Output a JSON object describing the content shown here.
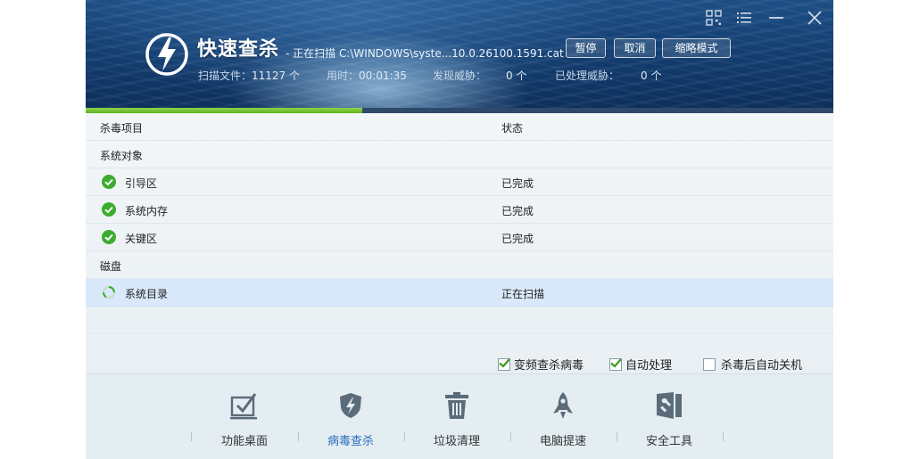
{
  "header": {
    "title": "快速查杀",
    "scan_status": " - 正在扫描 C:\\WINDOWS\\syste...10.0.26100.1591.cat",
    "buttons": {
      "pause": "暂停",
      "cancel": "取消",
      "mini": "缩略模式"
    },
    "stats": {
      "files_label": "扫描文件：",
      "files_value": "11127 个",
      "time_label": "用时：",
      "time_value": "00:01:35",
      "threats_label": "发现威胁：",
      "threats_value": "0 个",
      "handled_label": "已处理威胁：",
      "handled_value": "0 个"
    }
  },
  "progress": {
    "fraction": 0.37
  },
  "table": {
    "col_item": "杀毒项目",
    "col_status": "状态",
    "group_system": "系统对象",
    "rows": [
      {
        "name": "引导区",
        "status": "已完成"
      },
      {
        "name": "系统内存",
        "status": "已完成"
      },
      {
        "name": "关键区",
        "status": "已完成"
      }
    ],
    "group_disk": "磁盘",
    "scanning_row": {
      "name": "系统目录",
      "status": "正在扫描"
    }
  },
  "options": {
    "freq": "变频查杀病毒",
    "auto": "自动处理",
    "shutdown": "杀毒后自动关机"
  },
  "nav": {
    "desktop": "功能桌面",
    "virus": "病毒查杀",
    "trash": "垃圾清理",
    "speed": "电脑提速",
    "tools": "安全工具"
  },
  "colors": {
    "accent": "#2a6fb8",
    "progress": "#6cc02a",
    "header": "#143f72"
  }
}
